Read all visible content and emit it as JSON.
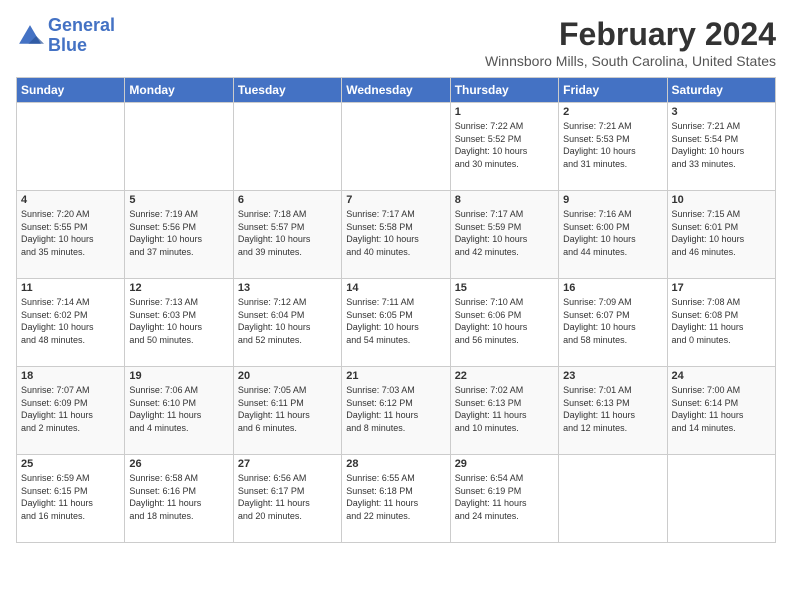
{
  "logo": {
    "line1": "General",
    "line2": "Blue"
  },
  "title": "February 2024",
  "location": "Winnsboro Mills, South Carolina, United States",
  "days_header": [
    "Sunday",
    "Monday",
    "Tuesday",
    "Wednesday",
    "Thursday",
    "Friday",
    "Saturday"
  ],
  "weeks": [
    [
      {
        "day": "",
        "info": ""
      },
      {
        "day": "",
        "info": ""
      },
      {
        "day": "",
        "info": ""
      },
      {
        "day": "",
        "info": ""
      },
      {
        "day": "1",
        "info": "Sunrise: 7:22 AM\nSunset: 5:52 PM\nDaylight: 10 hours\nand 30 minutes."
      },
      {
        "day": "2",
        "info": "Sunrise: 7:21 AM\nSunset: 5:53 PM\nDaylight: 10 hours\nand 31 minutes."
      },
      {
        "day": "3",
        "info": "Sunrise: 7:21 AM\nSunset: 5:54 PM\nDaylight: 10 hours\nand 33 minutes."
      }
    ],
    [
      {
        "day": "4",
        "info": "Sunrise: 7:20 AM\nSunset: 5:55 PM\nDaylight: 10 hours\nand 35 minutes."
      },
      {
        "day": "5",
        "info": "Sunrise: 7:19 AM\nSunset: 5:56 PM\nDaylight: 10 hours\nand 37 minutes."
      },
      {
        "day": "6",
        "info": "Sunrise: 7:18 AM\nSunset: 5:57 PM\nDaylight: 10 hours\nand 39 minutes."
      },
      {
        "day": "7",
        "info": "Sunrise: 7:17 AM\nSunset: 5:58 PM\nDaylight: 10 hours\nand 40 minutes."
      },
      {
        "day": "8",
        "info": "Sunrise: 7:17 AM\nSunset: 5:59 PM\nDaylight: 10 hours\nand 42 minutes."
      },
      {
        "day": "9",
        "info": "Sunrise: 7:16 AM\nSunset: 6:00 PM\nDaylight: 10 hours\nand 44 minutes."
      },
      {
        "day": "10",
        "info": "Sunrise: 7:15 AM\nSunset: 6:01 PM\nDaylight: 10 hours\nand 46 minutes."
      }
    ],
    [
      {
        "day": "11",
        "info": "Sunrise: 7:14 AM\nSunset: 6:02 PM\nDaylight: 10 hours\nand 48 minutes."
      },
      {
        "day": "12",
        "info": "Sunrise: 7:13 AM\nSunset: 6:03 PM\nDaylight: 10 hours\nand 50 minutes."
      },
      {
        "day": "13",
        "info": "Sunrise: 7:12 AM\nSunset: 6:04 PM\nDaylight: 10 hours\nand 52 minutes."
      },
      {
        "day": "14",
        "info": "Sunrise: 7:11 AM\nSunset: 6:05 PM\nDaylight: 10 hours\nand 54 minutes."
      },
      {
        "day": "15",
        "info": "Sunrise: 7:10 AM\nSunset: 6:06 PM\nDaylight: 10 hours\nand 56 minutes."
      },
      {
        "day": "16",
        "info": "Sunrise: 7:09 AM\nSunset: 6:07 PM\nDaylight: 10 hours\nand 58 minutes."
      },
      {
        "day": "17",
        "info": "Sunrise: 7:08 AM\nSunset: 6:08 PM\nDaylight: 11 hours\nand 0 minutes."
      }
    ],
    [
      {
        "day": "18",
        "info": "Sunrise: 7:07 AM\nSunset: 6:09 PM\nDaylight: 11 hours\nand 2 minutes."
      },
      {
        "day": "19",
        "info": "Sunrise: 7:06 AM\nSunset: 6:10 PM\nDaylight: 11 hours\nand 4 minutes."
      },
      {
        "day": "20",
        "info": "Sunrise: 7:05 AM\nSunset: 6:11 PM\nDaylight: 11 hours\nand 6 minutes."
      },
      {
        "day": "21",
        "info": "Sunrise: 7:03 AM\nSunset: 6:12 PM\nDaylight: 11 hours\nand 8 minutes."
      },
      {
        "day": "22",
        "info": "Sunrise: 7:02 AM\nSunset: 6:13 PM\nDaylight: 11 hours\nand 10 minutes."
      },
      {
        "day": "23",
        "info": "Sunrise: 7:01 AM\nSunset: 6:13 PM\nDaylight: 11 hours\nand 12 minutes."
      },
      {
        "day": "24",
        "info": "Sunrise: 7:00 AM\nSunset: 6:14 PM\nDaylight: 11 hours\nand 14 minutes."
      }
    ],
    [
      {
        "day": "25",
        "info": "Sunrise: 6:59 AM\nSunset: 6:15 PM\nDaylight: 11 hours\nand 16 minutes."
      },
      {
        "day": "26",
        "info": "Sunrise: 6:58 AM\nSunset: 6:16 PM\nDaylight: 11 hours\nand 18 minutes."
      },
      {
        "day": "27",
        "info": "Sunrise: 6:56 AM\nSunset: 6:17 PM\nDaylight: 11 hours\nand 20 minutes."
      },
      {
        "day": "28",
        "info": "Sunrise: 6:55 AM\nSunset: 6:18 PM\nDaylight: 11 hours\nand 22 minutes."
      },
      {
        "day": "29",
        "info": "Sunrise: 6:54 AM\nSunset: 6:19 PM\nDaylight: 11 hours\nand 24 minutes."
      },
      {
        "day": "",
        "info": ""
      },
      {
        "day": "",
        "info": ""
      }
    ]
  ]
}
